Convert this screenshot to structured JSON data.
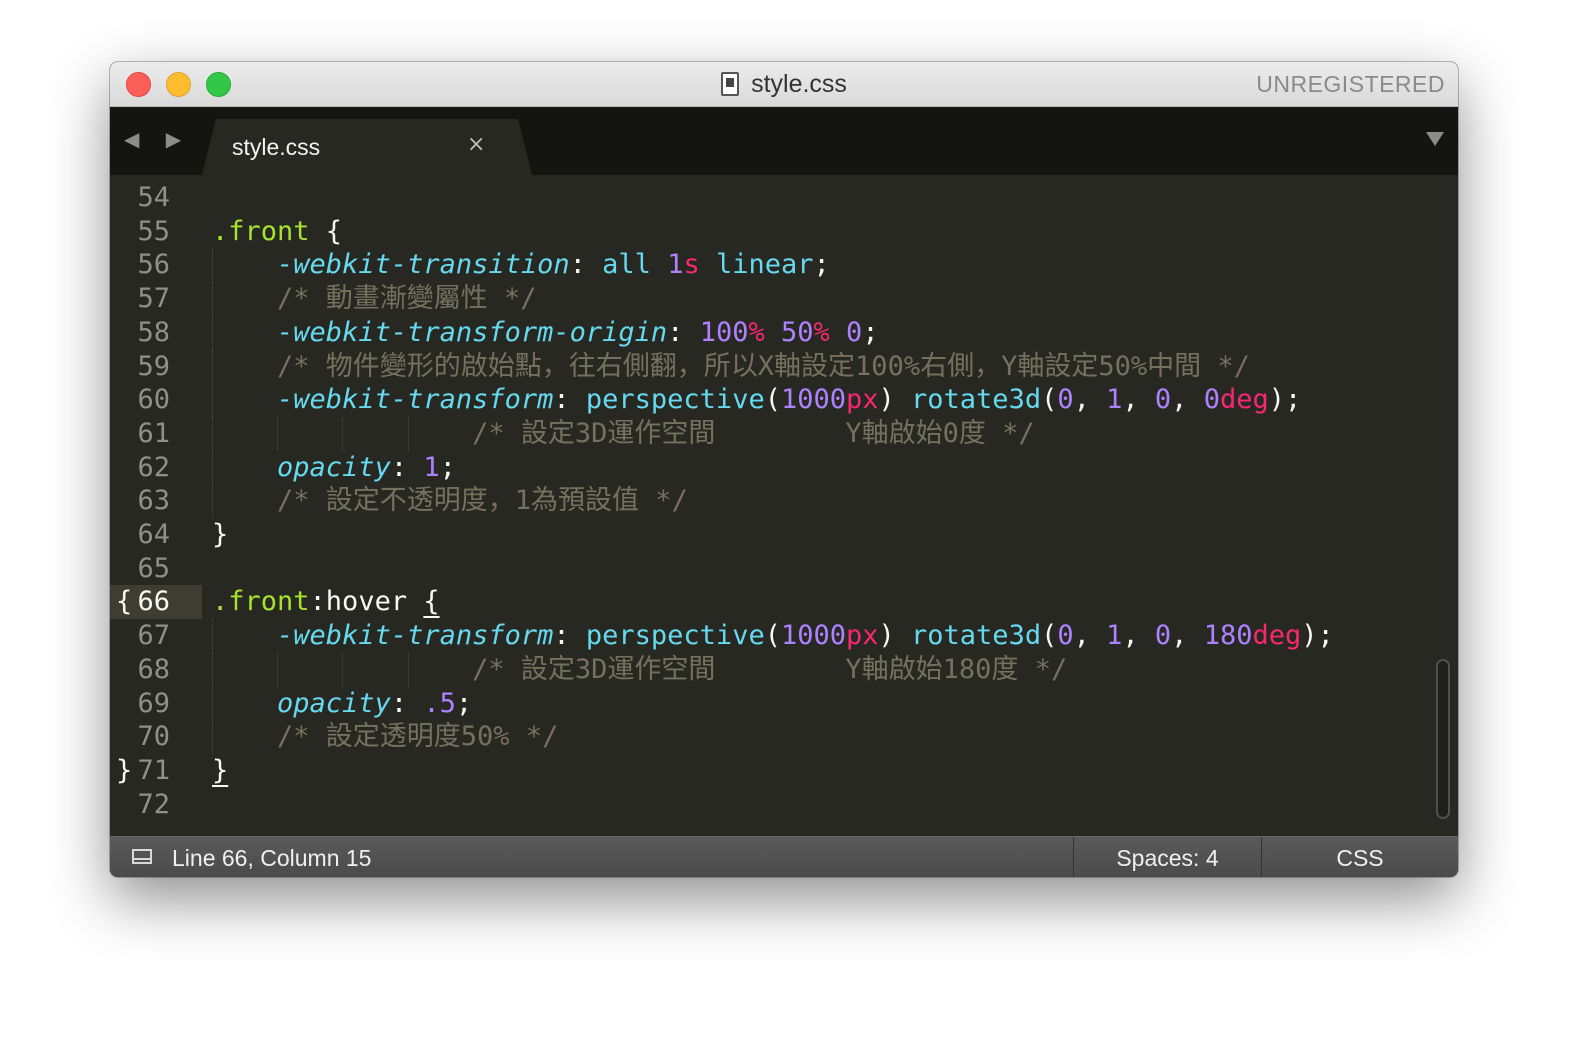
{
  "window": {
    "title": "style.css",
    "unregistered_label": "UNREGISTERED"
  },
  "tabs": {
    "nav_arrows": "◀ ▶",
    "active_tab": {
      "label": "style.css",
      "close_glyph": "×"
    },
    "menu_icon": "chevron-down-icon"
  },
  "editor": {
    "current_line": 66,
    "lines": [
      {
        "n": "54",
        "fold": "",
        "tokens": []
      },
      {
        "n": "55",
        "fold": "",
        "tokens": [
          {
            "c": "sel",
            "t": ".front"
          },
          {
            "c": "p",
            "t": " {"
          }
        ]
      },
      {
        "n": "56",
        "fold": "",
        "tokens": [
          {
            "c": "p",
            "t": "    "
          },
          {
            "c": "prop",
            "t": "-webkit-transition"
          },
          {
            "c": "p",
            "t": ": "
          },
          {
            "c": "fn",
            "t": "all "
          },
          {
            "c": "num",
            "t": "1"
          },
          {
            "c": "unit",
            "t": "s"
          },
          {
            "c": "fn",
            "t": " linear"
          },
          {
            "c": "p",
            "t": ";"
          }
        ]
      },
      {
        "n": "57",
        "fold": "",
        "tokens": [
          {
            "c": "p",
            "t": "    "
          },
          {
            "c": "com",
            "t": "/* 動畫漸變屬性 */"
          }
        ]
      },
      {
        "n": "58",
        "fold": "",
        "tokens": [
          {
            "c": "p",
            "t": "    "
          },
          {
            "c": "prop",
            "t": "-webkit-transform-origin"
          },
          {
            "c": "p",
            "t": ": "
          },
          {
            "c": "num",
            "t": "100"
          },
          {
            "c": "unit",
            "t": "%"
          },
          {
            "c": "p",
            "t": " "
          },
          {
            "c": "num",
            "t": "50"
          },
          {
            "c": "unit",
            "t": "%"
          },
          {
            "c": "p",
            "t": " "
          },
          {
            "c": "num",
            "t": "0"
          },
          {
            "c": "p",
            "t": ";"
          }
        ]
      },
      {
        "n": "59",
        "fold": "",
        "tokens": [
          {
            "c": "p",
            "t": "    "
          },
          {
            "c": "com",
            "t": "/* 物件變形的啟始點，往右側翻，所以X軸設定100%右側，Y軸設定50%中間 */"
          }
        ]
      },
      {
        "n": "60",
        "fold": "",
        "tokens": [
          {
            "c": "p",
            "t": "    "
          },
          {
            "c": "prop",
            "t": "-webkit-transform"
          },
          {
            "c": "p",
            "t": ": "
          },
          {
            "c": "fn",
            "t": "perspective"
          },
          {
            "c": "p",
            "t": "("
          },
          {
            "c": "num",
            "t": "1000"
          },
          {
            "c": "unit",
            "t": "px"
          },
          {
            "c": "p",
            "t": ") "
          },
          {
            "c": "fn",
            "t": "rotate3d"
          },
          {
            "c": "p",
            "t": "("
          },
          {
            "c": "num",
            "t": "0"
          },
          {
            "c": "p",
            "t": ", "
          },
          {
            "c": "num",
            "t": "1"
          },
          {
            "c": "p",
            "t": ", "
          },
          {
            "c": "num",
            "t": "0"
          },
          {
            "c": "p",
            "t": ", "
          },
          {
            "c": "num",
            "t": "0"
          },
          {
            "c": "unit",
            "t": "deg"
          },
          {
            "c": "p",
            "t": ");"
          }
        ]
      },
      {
        "n": "61",
        "fold": "",
        "tokens": [
          {
            "c": "p",
            "t": "                "
          },
          {
            "c": "com",
            "t": "/* 設定3D運作空間        Y軸啟始0度 */"
          }
        ]
      },
      {
        "n": "62",
        "fold": "",
        "tokens": [
          {
            "c": "p",
            "t": "    "
          },
          {
            "c": "prop",
            "t": "opacity"
          },
          {
            "c": "p",
            "t": ": "
          },
          {
            "c": "num",
            "t": "1"
          },
          {
            "c": "p",
            "t": ";"
          }
        ]
      },
      {
        "n": "63",
        "fold": "",
        "tokens": [
          {
            "c": "p",
            "t": "    "
          },
          {
            "c": "com",
            "t": "/* 設定不透明度，1為預設值 */"
          }
        ]
      },
      {
        "n": "64",
        "fold": "",
        "tokens": [
          {
            "c": "p",
            "t": "}"
          }
        ]
      },
      {
        "n": "65",
        "fold": "",
        "tokens": []
      },
      {
        "n": "66",
        "fold": "{",
        "tokens": [
          {
            "c": "sel",
            "t": ".front"
          },
          {
            "c": "p",
            "t": ":hover "
          },
          {
            "c": "p ul",
            "t": "{"
          }
        ]
      },
      {
        "n": "67",
        "fold": "",
        "tokens": [
          {
            "c": "p",
            "t": "    "
          },
          {
            "c": "prop",
            "t": "-webkit-transform"
          },
          {
            "c": "p",
            "t": ": "
          },
          {
            "c": "fn",
            "t": "perspective"
          },
          {
            "c": "p",
            "t": "("
          },
          {
            "c": "num",
            "t": "1000"
          },
          {
            "c": "unit",
            "t": "px"
          },
          {
            "c": "p",
            "t": ") "
          },
          {
            "c": "fn",
            "t": "rotate3d"
          },
          {
            "c": "p",
            "t": "("
          },
          {
            "c": "num",
            "t": "0"
          },
          {
            "c": "p",
            "t": ", "
          },
          {
            "c": "num",
            "t": "1"
          },
          {
            "c": "p",
            "t": ", "
          },
          {
            "c": "num",
            "t": "0"
          },
          {
            "c": "p",
            "t": ", "
          },
          {
            "c": "num",
            "t": "180"
          },
          {
            "c": "unit",
            "t": "deg"
          },
          {
            "c": "p",
            "t": ");"
          }
        ]
      },
      {
        "n": "68",
        "fold": "",
        "tokens": [
          {
            "c": "p",
            "t": "                "
          },
          {
            "c": "com",
            "t": "/* 設定3D運作空間        Y軸啟始180度 */"
          }
        ]
      },
      {
        "n": "69",
        "fold": "",
        "tokens": [
          {
            "c": "p",
            "t": "    "
          },
          {
            "c": "prop",
            "t": "opacity"
          },
          {
            "c": "p",
            "t": ": "
          },
          {
            "c": "num",
            "t": ".5"
          },
          {
            "c": "p",
            "t": ";"
          }
        ]
      },
      {
        "n": "70",
        "fold": "",
        "tokens": [
          {
            "c": "p",
            "t": "    "
          },
          {
            "c": "com",
            "t": "/* 設定透明度50% */"
          }
        ]
      },
      {
        "n": "71",
        "fold": "}",
        "tokens": [
          {
            "c": "p ul",
            "t": "}"
          }
        ]
      },
      {
        "n": "72",
        "fold": "",
        "tokens": []
      }
    ]
  },
  "statusbar": {
    "position": "Line 66, Column 15",
    "indentation": "Spaces: 4",
    "syntax": "CSS"
  },
  "colors": {
    "background": "#272822",
    "selector": "#a6e22e",
    "property": "#66d9ef",
    "number": "#ae81ff",
    "unit": "#f92672",
    "comment": "#75715e",
    "text": "#f8f8f2"
  }
}
